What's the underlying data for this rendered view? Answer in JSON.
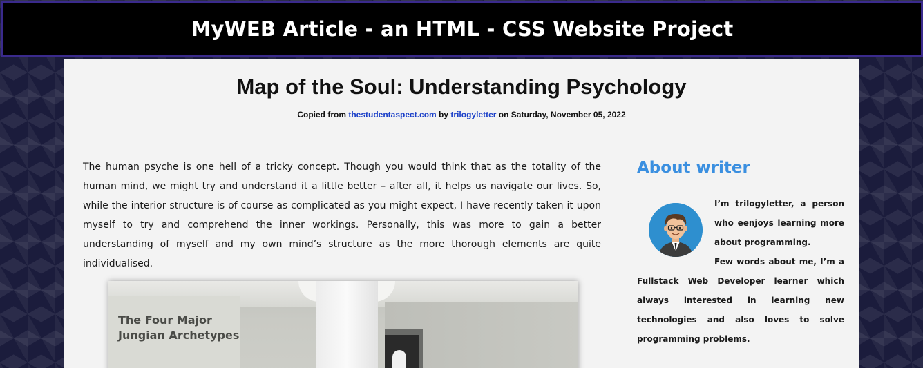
{
  "header": {
    "site_title": "MyWEB Article - an HTML - CSS Website Project"
  },
  "article": {
    "title": "Map of the Soul: Understanding Psychology",
    "byline": {
      "copied_from_label": "Copied from",
      "source_link": "thestudentaspect.com",
      "by_label": "by",
      "author_link": "trilogyletter",
      "on_label": "on",
      "date": "Saturday, November 05, 2022"
    },
    "body_paragraph": "The human psyche is one hell of a tricky concept. Though you would think that as the totality of the human mind, we might try and understand it a little better – after all, it helps us navigate our lives. So, while the interior structure is of course as complicated as you might expect, I have recently taken it upon myself to try and comprehend the inner workings. Personally, this was more to gain a better understanding of myself and my own mind’s structure as the more thorough elements are quite individualised.",
    "image_caption": "The Four Major\nJungian Archetypes"
  },
  "sidebar": {
    "heading": "About writer",
    "bio_line1": "I’m trilogyletter, a person who eenjoys learning more about programming.",
    "bio_line2": "Few words about me, I’m a Fullstack Web Developer learner which always interested in learning new technologies and also loves to solve programming problems."
  },
  "colors": {
    "header_bg": "#000000",
    "header_border": "#3a2a8c",
    "page_bg": "#1b1c3c",
    "content_bg": "#f3f3f3",
    "link": "#1a3fc8",
    "sidebar_heading": "#3a8fe0"
  }
}
